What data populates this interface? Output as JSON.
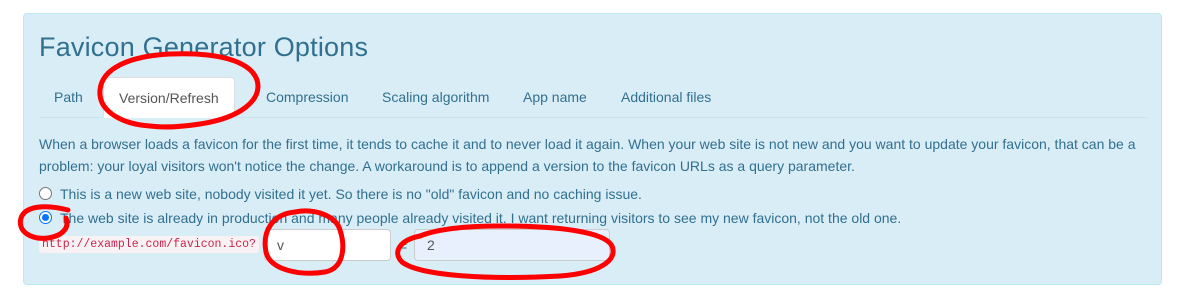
{
  "title": "Favicon Generator Options",
  "tabs": [
    {
      "label": "Path"
    },
    {
      "label": "Version/Refresh"
    },
    {
      "label": "Compression"
    },
    {
      "label": "Scaling algorithm"
    },
    {
      "label": "App name"
    },
    {
      "label": "Additional files"
    }
  ],
  "active_tab": "Version/Refresh",
  "description": "When a browser loads a favicon for the first time, it tends to cache it and to never load it again. When your web site is not new and you want to update your favicon, that can be a problem: your loyal visitors won't notice the change. A workaround is to append a version to the favicon URLs as a query parameter.",
  "options": [
    {
      "label": "This is a new web site, nobody visited it yet. So there is no \"old\" favicon and no caching issue.",
      "checked": false
    },
    {
      "label": "The web site is already in production and many people already visited it. I want returning visitors to see my new favicon, not the old one.",
      "checked": true
    }
  ],
  "version": {
    "url_prefix": "http://example.com/favicon.ico?",
    "param_name": "v",
    "equals": "=",
    "param_value": "2"
  },
  "annotation_color": "#ff0000"
}
